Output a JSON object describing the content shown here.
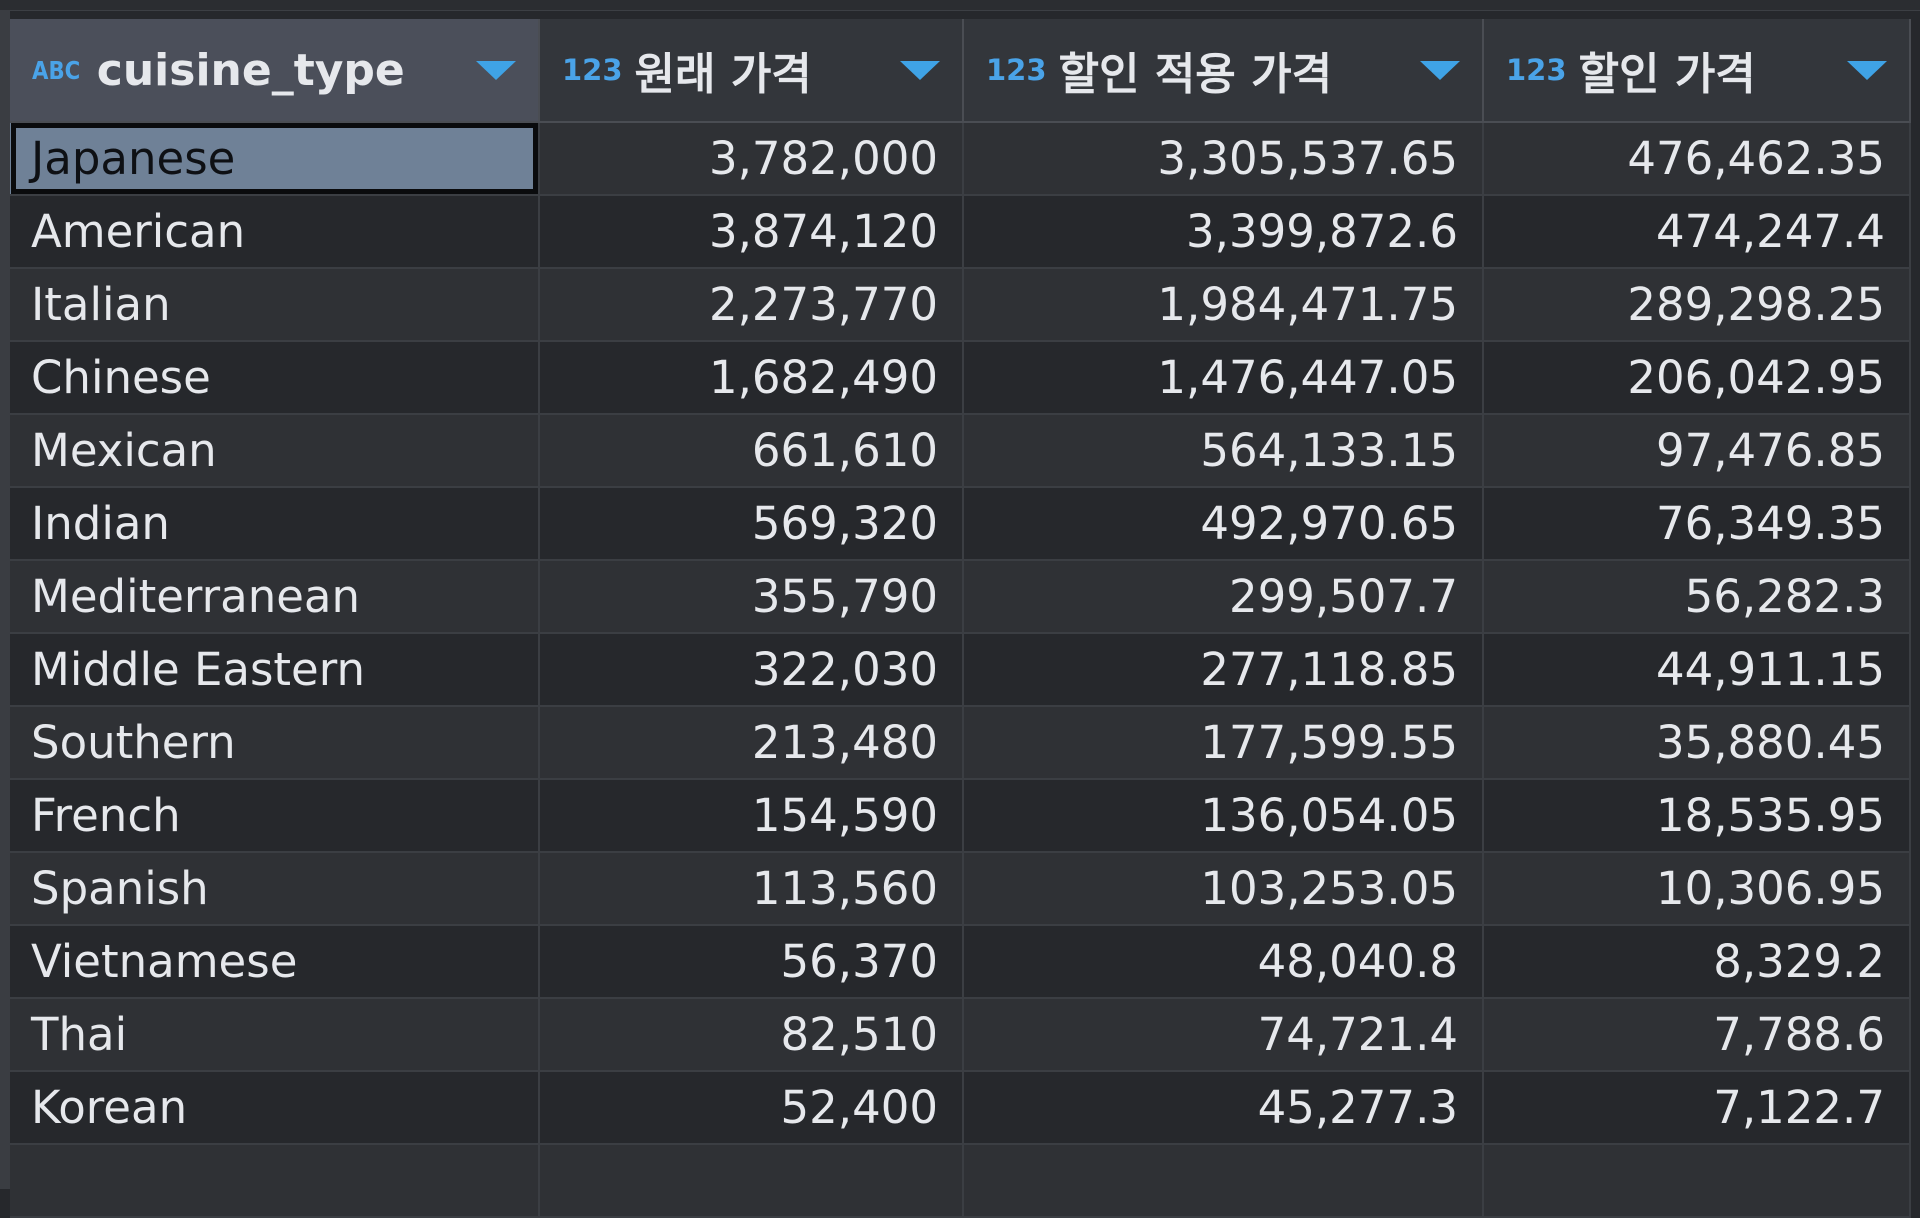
{
  "grid": {
    "columns": [
      {
        "type_badge": "ABC",
        "label": "cuisine_type",
        "sort_icon": "chevron-down-icon"
      },
      {
        "type_badge": "123",
        "label": "원래 가격",
        "sort_icon": "chevron-down-icon"
      },
      {
        "type_badge": "123",
        "label": "할인 적용 가격",
        "sort_icon": "chevron-down-icon"
      },
      {
        "type_badge": "123",
        "label": "할인 가격",
        "sort_icon": "chevron-down-icon"
      }
    ],
    "rows": [
      [
        "Japanese",
        "3,782,000",
        "3,305,537.65",
        "476,462.35"
      ],
      [
        "American",
        "3,874,120",
        "3,399,872.6",
        "474,247.4"
      ],
      [
        "Italian",
        "2,273,770",
        "1,984,471.75",
        "289,298.25"
      ],
      [
        "Chinese",
        "1,682,490",
        "1,476,447.05",
        "206,042.95"
      ],
      [
        "Mexican",
        "661,610",
        "564,133.15",
        "97,476.85"
      ],
      [
        "Indian",
        "569,320",
        "492,970.65",
        "76,349.35"
      ],
      [
        "Mediterranean",
        "355,790",
        "299,507.7",
        "56,282.3"
      ],
      [
        "Middle Eastern",
        "322,030",
        "277,118.85",
        "44,911.15"
      ],
      [
        "Southern",
        "213,480",
        "177,599.55",
        "35,880.45"
      ],
      [
        "French",
        "154,590",
        "136,054.05",
        "18,535.95"
      ],
      [
        "Spanish",
        "113,560",
        "103,253.05",
        "10,306.95"
      ],
      [
        "Vietnamese",
        "56,370",
        "48,040.8",
        "8,329.2"
      ],
      [
        "Thai",
        "82,510",
        "74,721.4",
        "7,788.6"
      ],
      [
        "Korean",
        "52,400",
        "45,277.3",
        "7,122.7"
      ]
    ],
    "selected_cell": {
      "row": 0,
      "col": 0
    },
    "colors": {
      "background": "#26282c",
      "header": "#33363b",
      "header_selected": "#4b4f5a",
      "type_badge": "#4aa3e8",
      "selected_cell": "#6f8197",
      "text": "#e6e8ec"
    }
  }
}
